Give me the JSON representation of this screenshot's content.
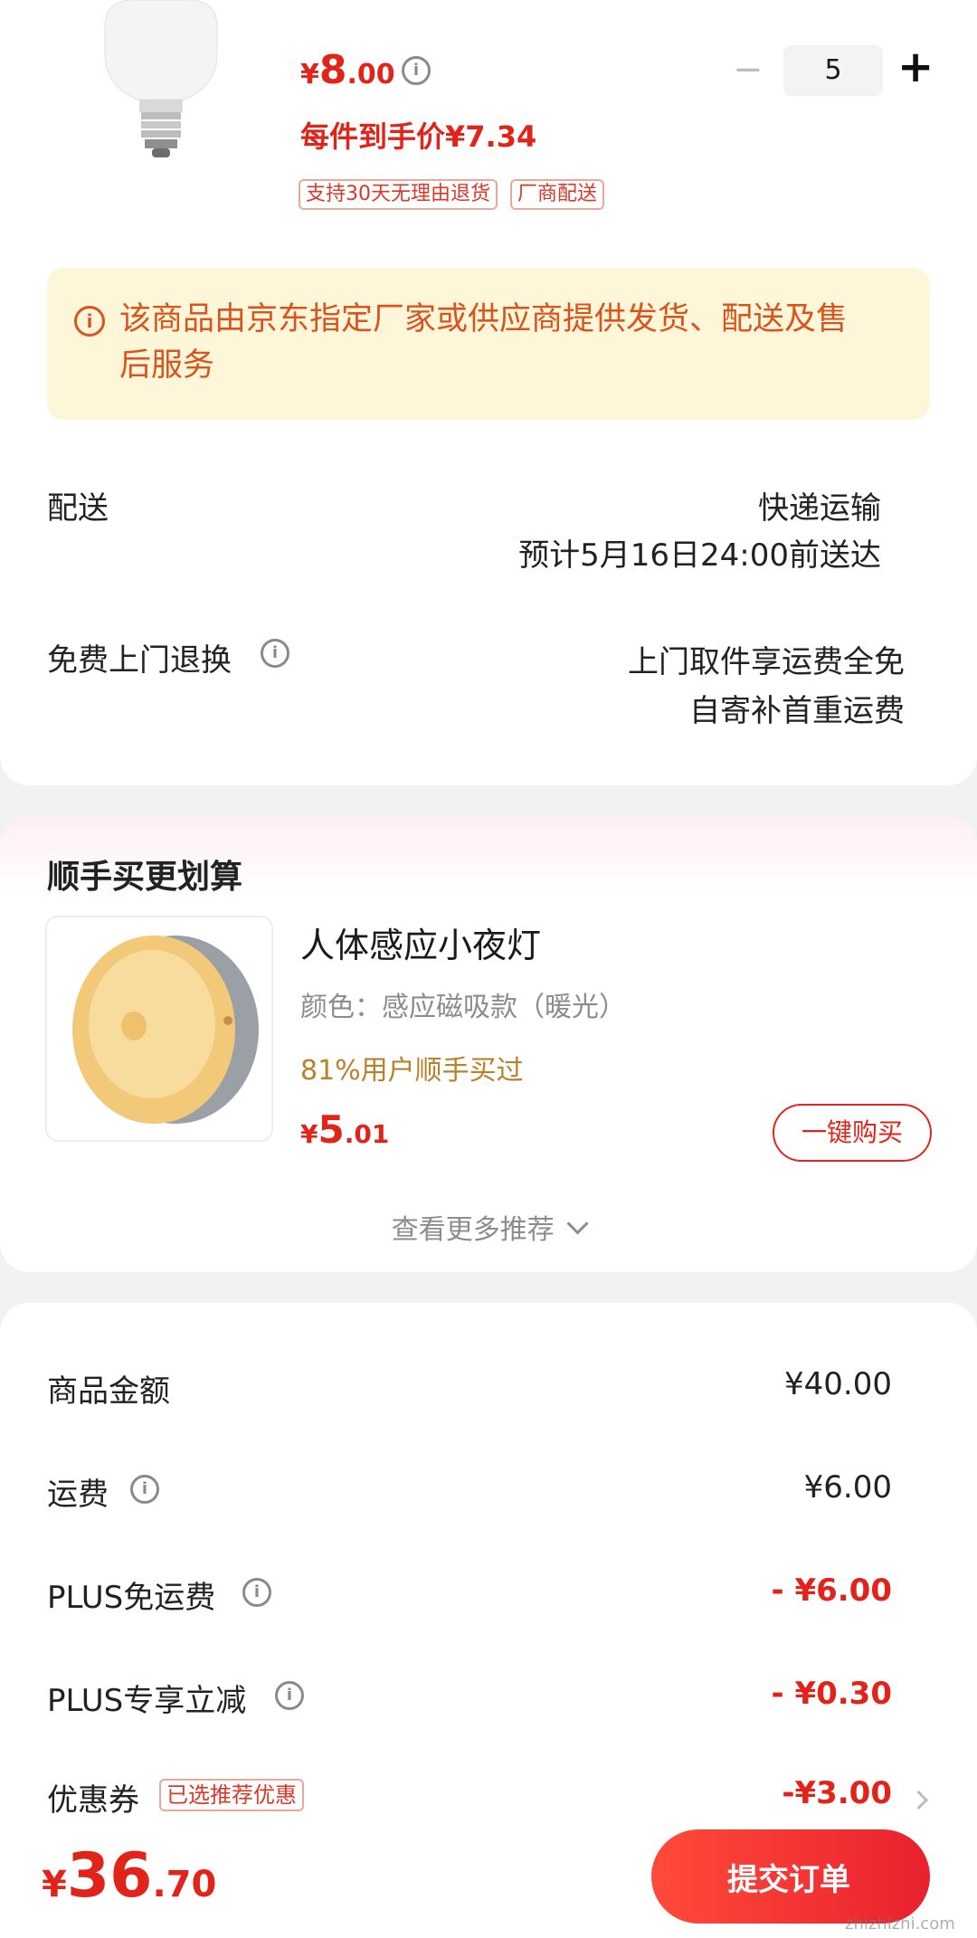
{
  "product": {
    "price_symbol": "¥",
    "price_int": "8",
    "price_dec": ".00",
    "quantity": "5",
    "minus": "−",
    "plus": "+",
    "per_item_price": "每件到手价¥7.34",
    "tags": [
      "支持30天无理由退货",
      "厂商配送"
    ]
  },
  "notice": {
    "icon": "info-icon",
    "text": "该商品由京东指定厂家或供应商提供发货、配送及售后服务"
  },
  "delivery": {
    "label": "配送",
    "method": "快递运输",
    "eta": "预计5月16日24:00前送达"
  },
  "returns": {
    "label": "免费上门退换",
    "line1": "上门取件享运费全免",
    "line2": "自寄补首重运费"
  },
  "recommend": {
    "section_title": "顺手买更划算",
    "item": {
      "name": "人体感应小夜灯",
      "variant": "颜色：感应磁吸款（暖光）",
      "stat": "81%用户顺手买过",
      "price_symbol": "¥",
      "price_int": "5",
      "price_dec": ".01",
      "buy_label": "一键购买"
    },
    "more_label": "查看更多推荐"
  },
  "summary": {
    "rows": [
      {
        "label": "商品金额",
        "value": "¥40.00"
      },
      {
        "label": "运费",
        "value": "¥6.00"
      },
      {
        "label": "PLUS免运费",
        "value": "- ¥6.00"
      },
      {
        "label": "PLUS专享立减",
        "value": "- ¥0.30"
      },
      {
        "label": "优惠券",
        "value": "-¥3.00",
        "badge": "已选推荐优惠"
      }
    ]
  },
  "footer": {
    "total_symbol": "¥",
    "total_int": "36",
    "total_dec": ".70",
    "submit_label": "提交订单",
    "watermark": "zhizhizhi.com"
  },
  "colors": {
    "accent": "#e2231a",
    "notice_bg": "#fdf6d8",
    "notice_text": "#d9541e",
    "stat_text": "#b8812a"
  }
}
